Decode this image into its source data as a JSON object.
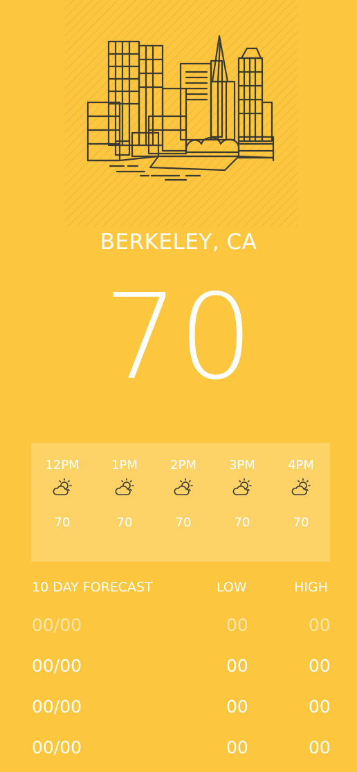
{
  "header": {
    "city": "BERKELEY, CA"
  },
  "current": {
    "temperature": "70"
  },
  "hourly": [
    {
      "time": "12PM",
      "icon": "partly-cloudy-icon",
      "temp": "70"
    },
    {
      "time": "1PM",
      "icon": "partly-cloudy-icon",
      "temp": "70"
    },
    {
      "time": "2PM",
      "icon": "partly-cloudy-icon",
      "temp": "70"
    },
    {
      "time": "3PM",
      "icon": "partly-cloudy-icon",
      "temp": "70"
    },
    {
      "time": "4PM",
      "icon": "partly-cloudy-icon",
      "temp": "70"
    }
  ],
  "forecast": {
    "title": "10 DAY FORECAST",
    "low_label": "LOW",
    "high_label": "HIGH",
    "rows": [
      {
        "date": "00/00",
        "low": "00",
        "high": "00"
      },
      {
        "date": "00/00",
        "low": "00",
        "high": "00"
      },
      {
        "date": "00/00",
        "low": "00",
        "high": "00"
      },
      {
        "date": "00/00",
        "low": "00",
        "high": "00"
      }
    ]
  },
  "colors": {
    "background": "#fdc63f",
    "hourly_panel": "#fdd367",
    "text": "#ffffff",
    "illustration_stroke": "#3d3a30"
  },
  "illustration": {
    "icon": "city-skyline-icon"
  }
}
